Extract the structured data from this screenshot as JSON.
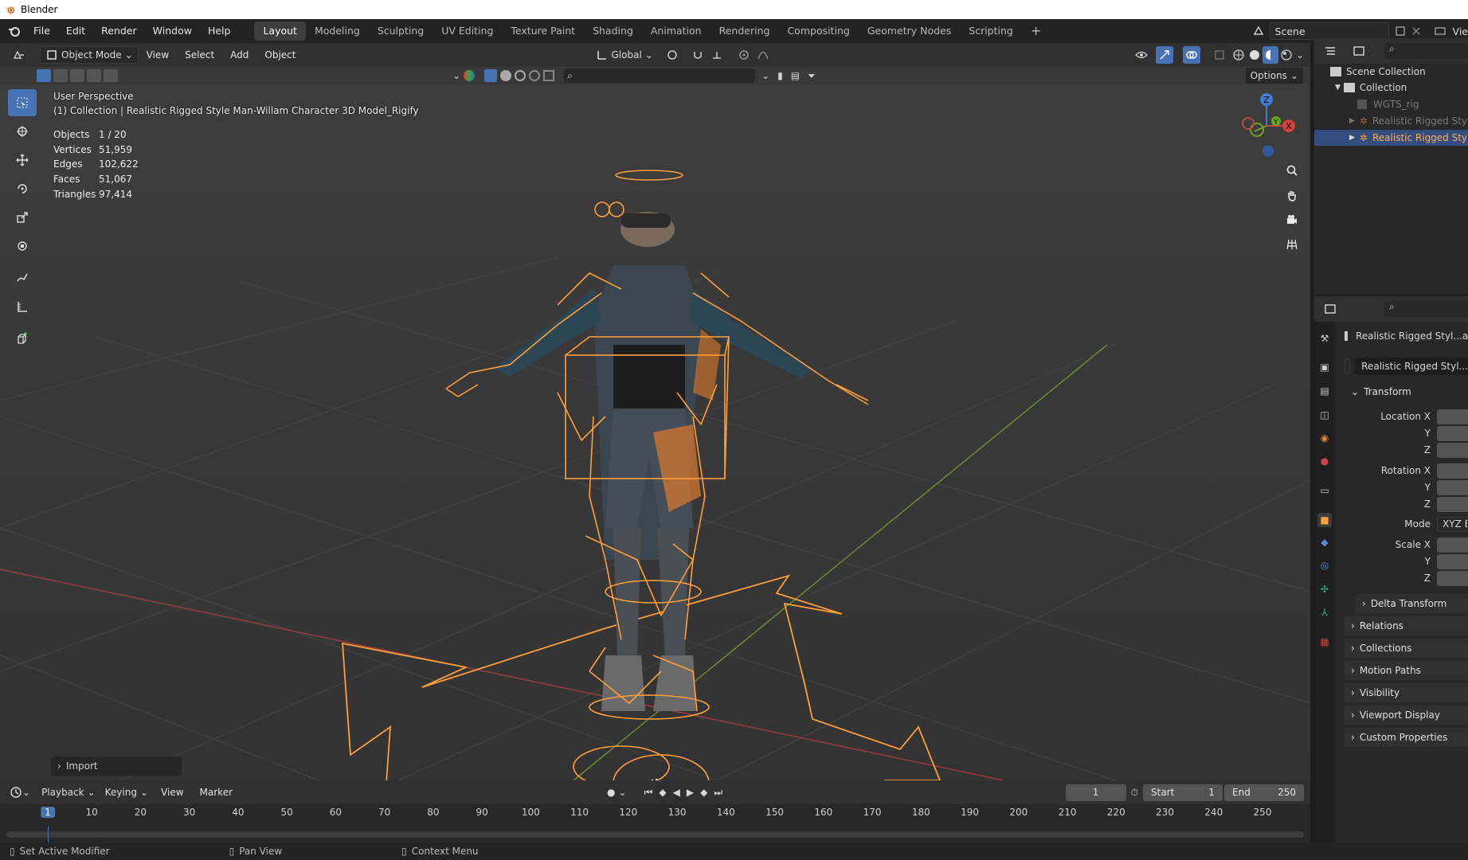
{
  "window": {
    "title": "Blender"
  },
  "menu": [
    "File",
    "Edit",
    "Render",
    "Window",
    "Help"
  ],
  "workspaces": [
    "Layout",
    "Modeling",
    "Sculpting",
    "UV Editing",
    "Texture Paint",
    "Shading",
    "Animation",
    "Rendering",
    "Compositing",
    "Geometry Nodes",
    "Scripting"
  ],
  "active_workspace": "Layout",
  "scene": {
    "label": "Scene",
    "view_layer_label": "Vie"
  },
  "viewport_header": {
    "mode": "Object Mode",
    "menus": [
      "View",
      "Select",
      "Add",
      "Object"
    ],
    "transform_orientation": "Global",
    "options_label": "Options"
  },
  "viewport": {
    "perspective": "User Perspective",
    "collection_line": "(1) Collection | Realistic Rigged Style Man-Willam Character 3D Model_Rigify",
    "stats": [
      {
        "label": "Objects",
        "value": "1 / 20"
      },
      {
        "label": "Vertices",
        "value": "51,959"
      },
      {
        "label": "Edges",
        "value": "102,622"
      },
      {
        "label": "Faces",
        "value": "51,067"
      },
      {
        "label": "Triangles",
        "value": "97,414"
      }
    ],
    "gizmo_axes": {
      "z": "Z",
      "y": "Y",
      "x": "X"
    },
    "last_operator": "Import"
  },
  "outliner": {
    "scene_collection": "Scene Collection",
    "collection": "Collection",
    "items": [
      "WGTS_rig",
      "Realistic Rigged Style",
      "Realistic Rigged Style"
    ]
  },
  "properties": {
    "object_name": "Realistic Rigged Styl...ac",
    "data_name": "Realistic Rigged Styl...",
    "transform_label": "Transform",
    "location": [
      "Location X",
      "Y",
      "Z"
    ],
    "rotation": [
      "Rotation X",
      "Y",
      "Z"
    ],
    "mode_label": "Mode",
    "mode_value": "XYZ E",
    "scale": [
      "Scale X",
      "Y",
      "Z"
    ],
    "delta_transform": "Delta Transform",
    "sections": [
      "Relations",
      "Collections",
      "Motion Paths",
      "Visibility",
      "Viewport Display",
      "Custom Properties"
    ]
  },
  "timeline": {
    "menus": [
      "Playback",
      "Keying",
      "View",
      "Marker"
    ],
    "current_frame": "1",
    "start_label": "Start",
    "start_value": "1",
    "end_label": "End",
    "end_value": "250",
    "ruler": [
      "1",
      "10",
      "20",
      "30",
      "40",
      "50",
      "60",
      "70",
      "80",
      "90",
      "100",
      "110",
      "120",
      "130",
      "140",
      "150",
      "160",
      "170",
      "180",
      "190",
      "200",
      "210",
      "220",
      "230",
      "240",
      "250"
    ]
  },
  "status_bar": [
    "Set Active Modifier",
    "Pan View",
    "Context Menu"
  ],
  "colors": {
    "accent": "#4772b3",
    "selection": "#ff9f3a",
    "x_axis": "#b83b45",
    "y_axis": "#5f8b2a"
  }
}
